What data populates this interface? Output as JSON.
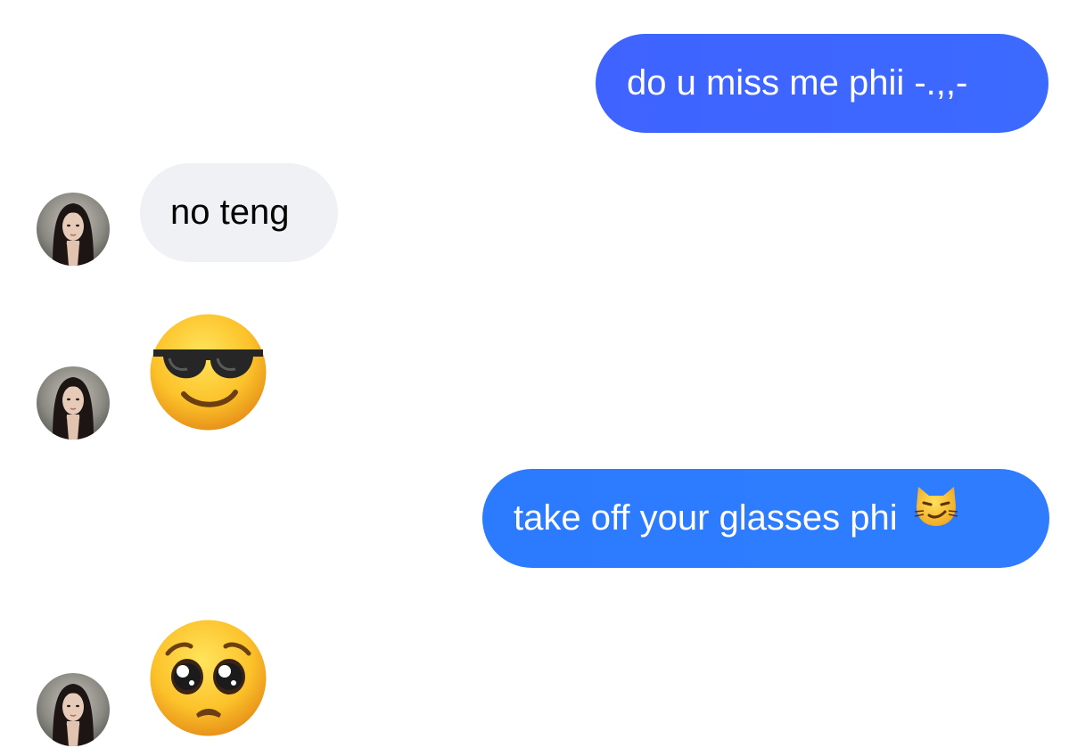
{
  "messages": [
    {
      "id": "msg1",
      "direction": "outgoing",
      "type": "text",
      "text": "do u miss me phii -.,,-"
    },
    {
      "id": "msg2",
      "direction": "incoming",
      "type": "text",
      "text": "no teng"
    },
    {
      "id": "msg3",
      "direction": "incoming",
      "type": "emoji",
      "emoji": "smiling-face-with-sunglasses"
    },
    {
      "id": "msg4",
      "direction": "outgoing",
      "type": "text",
      "text": "take off your glasses phi",
      "trailing_emoji": "cat-with-wry-smile"
    },
    {
      "id": "msg5",
      "direction": "incoming",
      "type": "emoji",
      "emoji": "pleading-face"
    }
  ],
  "colors": {
    "outgoing_bubble": "#3f63ff",
    "outgoing_bubble_alt": "#2c7bff",
    "incoming_bubble": "#f0f1f4",
    "outgoing_text": "#ffffff",
    "incoming_text": "#050505",
    "background": "#ffffff"
  }
}
